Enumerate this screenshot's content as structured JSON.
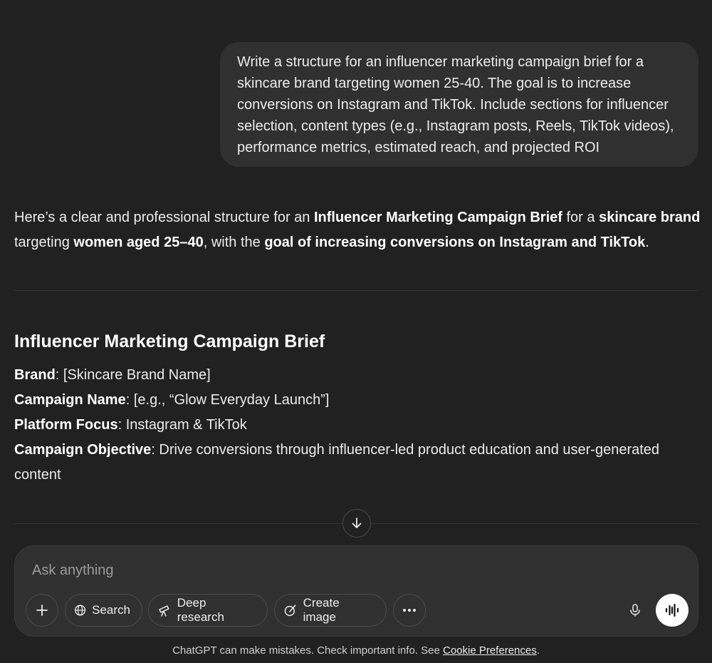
{
  "user_message": "Write a structure for an influencer marketing campaign brief for a skincare brand targeting women 25-40. The goal is to increase conversions on Instagram and TikTok. Include sections for influencer selection, content types (e.g., Instagram posts, Reels, TikTok videos), performance metrics, estimated reach, and projected ROI",
  "assistant": {
    "intro": {
      "p1": "Here’s a clear and professional structure for an ",
      "b1": "Influencer Marketing Campaign Brief",
      "p2": " for a ",
      "b2": "skincare brand",
      "p3": " targeting ",
      "b3": "women aged 25–40",
      "p4": ", with the ",
      "b4": "goal of increasing conversions on Instagram and TikTok",
      "p5": "."
    },
    "brief_title": "Influencer Marketing Campaign Brief",
    "fields": [
      {
        "key": "Brand",
        "value": ": [Skincare Brand Name]"
      },
      {
        "key": "Campaign Name",
        "value": ": [e.g., “Glow Everyday Launch”]"
      },
      {
        "key": "Platform Focus",
        "value": ": Instagram & TikTok"
      },
      {
        "key": "Campaign Objective",
        "value": ": Drive conversions through influencer-led product education and user-generated content"
      }
    ]
  },
  "composer": {
    "placeholder": "Ask anything",
    "search_label": "Search",
    "deep_research_label": "Deep research",
    "create_image_label": "Create image"
  },
  "footer": {
    "text": "ChatGPT can make mistakes. Check important info. See ",
    "link": "Cookie Preferences",
    "end": "."
  },
  "icons": {
    "add": "plus-icon",
    "search": "globe-icon",
    "deep_research": "telescope-icon",
    "create_image": "brush-icon",
    "more": "ellipsis-icon",
    "mic": "mic-icon",
    "voice": "voice-waveform-icon",
    "scroll": "arrow-down-icon"
  },
  "colors": {
    "background": "#212121",
    "bubble": "#303030",
    "text": "#ececec"
  }
}
